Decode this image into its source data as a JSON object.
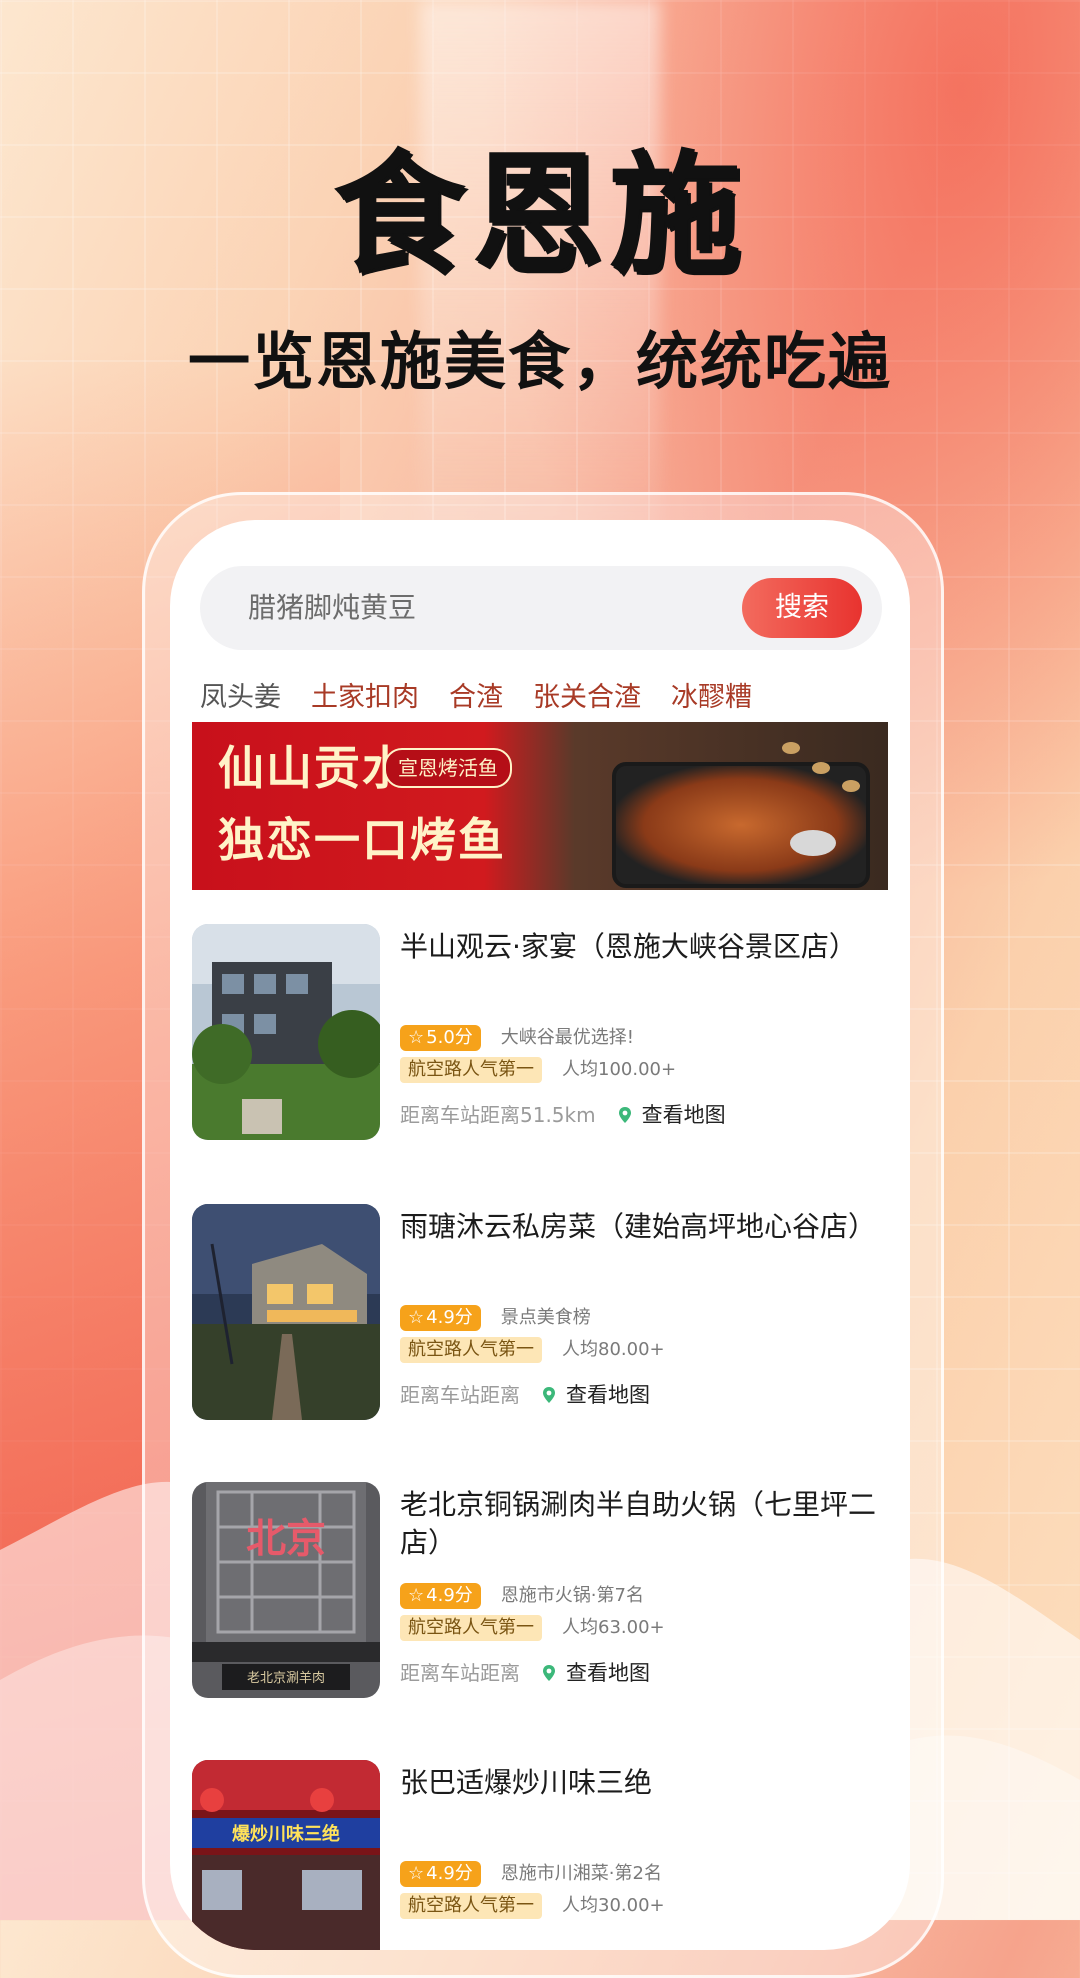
{
  "hero": {
    "title": "食恩施",
    "subtitle": "一览恩施美食，统统吃遍"
  },
  "search": {
    "placeholder": "腊猪脚炖黄豆",
    "button_label": "搜索"
  },
  "tags": [
    "凤头姜",
    "土家扣肉",
    "合渣",
    "张关合渣",
    "冰醪糟"
  ],
  "banner": {
    "line1": "仙山贡水",
    "line2": "独恋一口烤鱼",
    "pill": "宣恩烤活鱼"
  },
  "restaurants": [
    {
      "name": "半山观云·家宴（恩施大峡谷景区店）",
      "score": "5.0分",
      "note": "大峡谷最优选择!",
      "rank": "航空路人气第一",
      "price": "人均100.00+",
      "distance": "距离车站距离51.5km",
      "map_label": "查看地图"
    },
    {
      "name": "雨瑭沐云私房菜（建始高坪地心谷店）",
      "score": "4.9分",
      "note": "景点美食榜",
      "rank": "航空路人气第一",
      "price": "人均80.00+",
      "distance": "距离车站距离",
      "map_label": "查看地图"
    },
    {
      "name": "老北京铜锅涮肉半自助火锅（七里坪二店）",
      "score": "4.9分",
      "note": "恩施市火锅·第7名",
      "rank": "航空路人气第一",
      "price": "人均63.00+",
      "distance": "距离车站距离",
      "map_label": "查看地图",
      "sign_text": "北京",
      "plaque_text": "老北京涮羊肉"
    },
    {
      "name": "张巴适爆炒川味三绝",
      "score": "4.9分",
      "note": "恩施市川湘菜·第2名",
      "rank": "航空路人气第一",
      "price": "人均30.00+",
      "sign_text": "爆炒川味三绝"
    }
  ],
  "colors": {
    "accent": "#e8332f",
    "score_bg": "#f6a21a",
    "rank_bg": "#fde6b6",
    "tag_text": "#a83a26"
  }
}
